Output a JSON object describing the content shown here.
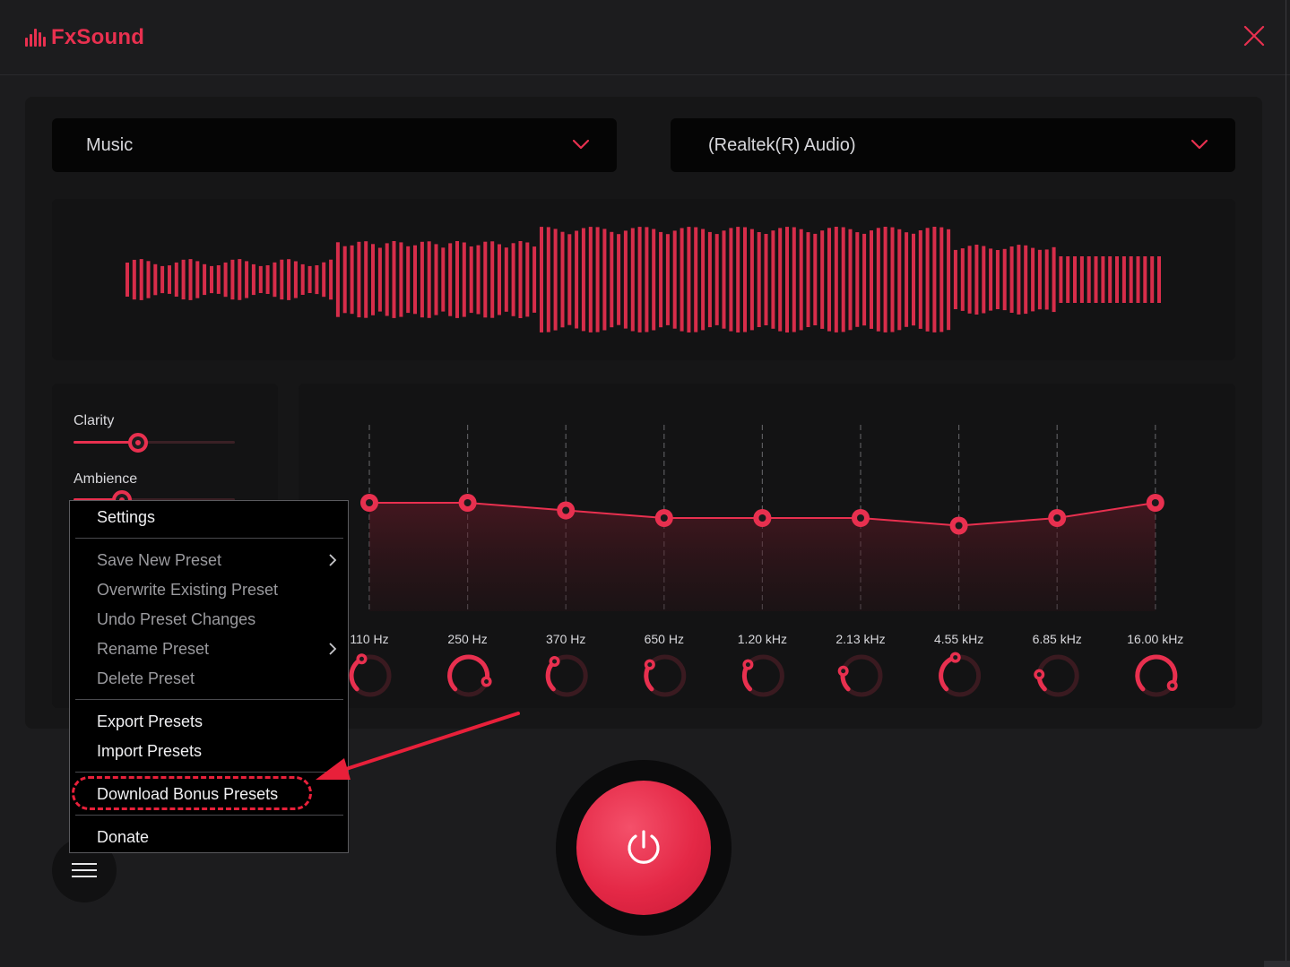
{
  "app": {
    "title": "FxSound"
  },
  "preset_dropdown": {
    "value": "Music"
  },
  "device_dropdown": {
    "value": "(Realtek(R) Audio)"
  },
  "effects": [
    {
      "label": "Clarity",
      "level": 0.4
    },
    {
      "label": "Ambience",
      "level": 0.3
    }
  ],
  "eq": {
    "bands": [
      {
        "label": "110 Hz",
        "gain": 0
      },
      {
        "label": "250 Hz",
        "gain": 0
      },
      {
        "label": "370 Hz",
        "gain": -0.5
      },
      {
        "label": "650 Hz",
        "gain": -1
      },
      {
        "label": "1.20 kHz",
        "gain": -1
      },
      {
        "label": "2.13 kHz",
        "gain": -1
      },
      {
        "label": "4.55 kHz",
        "gain": -1.5
      },
      {
        "label": "6.85 kHz",
        "gain": -1
      },
      {
        "label": "16.00 kHz",
        "gain": 0
      }
    ],
    "knobs": [
      0.4,
      0.9,
      0.35,
      0.3,
      0.3,
      0.22,
      0.45,
      0.18,
      0.95
    ]
  },
  "menu": {
    "settings": "Settings",
    "save_new_preset": "Save New Preset",
    "overwrite_existing_preset": "Overwrite Existing Preset",
    "undo_preset_changes": "Undo Preset Changes",
    "rename_preset": "Rename Preset",
    "delete_preset": "Delete Preset",
    "export_presets": "Export Presets",
    "import_presets": "Import Presets",
    "download_bonus_presets": "Download Bonus Presets",
    "donate": "Donate"
  },
  "colors": {
    "accent": "#e8304f",
    "background": "#1c1c1e",
    "panel": "#161617",
    "menu_bg": "#000000",
    "annotation": "#e8203a"
  },
  "icons": [
    "logo-bars-icon",
    "close-icon",
    "chevron-down-icon",
    "chevron-right-icon",
    "hamburger-icon",
    "power-icon"
  ]
}
